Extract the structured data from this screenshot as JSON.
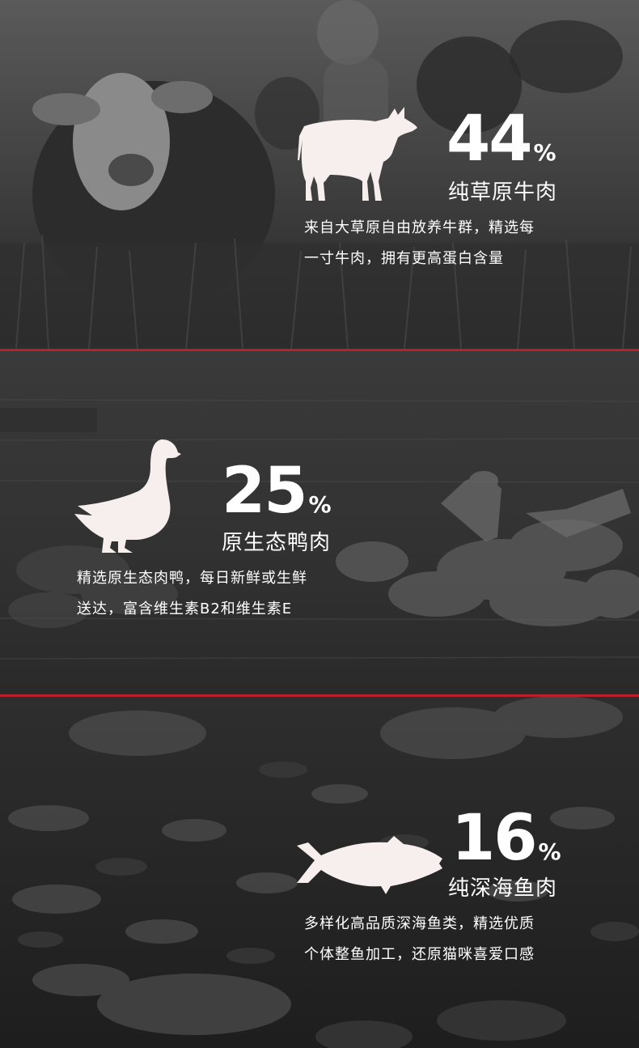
{
  "theme": {
    "divider_color": "#b8202b",
    "icon_color": "#f7eeee",
    "text_color": "#ffffff"
  },
  "sections": [
    {
      "icon": "cow-icon",
      "percent": "44",
      "percent_sign": "%",
      "name": "纯草原牛肉",
      "desc_line1": "来自大草原自由放养牛群，精选每",
      "desc_line2": "一寸牛肉，拥有更高蛋白含量"
    },
    {
      "icon": "goose-icon",
      "percent": "25",
      "percent_sign": "%",
      "name": "原生态鸭肉",
      "desc_line1": "精选原生态肉鸭，每日新鲜或生鲜",
      "desc_line2": "送达，富含维生素B2和维生素E"
    },
    {
      "icon": "fish-icon",
      "percent": "16",
      "percent_sign": "%",
      "name": "纯深海鱼肉",
      "desc_line1": "多样化高品质深海鱼类，精选优质",
      "desc_line2": "个体整鱼加工，还原猫咪喜爱口感"
    }
  ]
}
